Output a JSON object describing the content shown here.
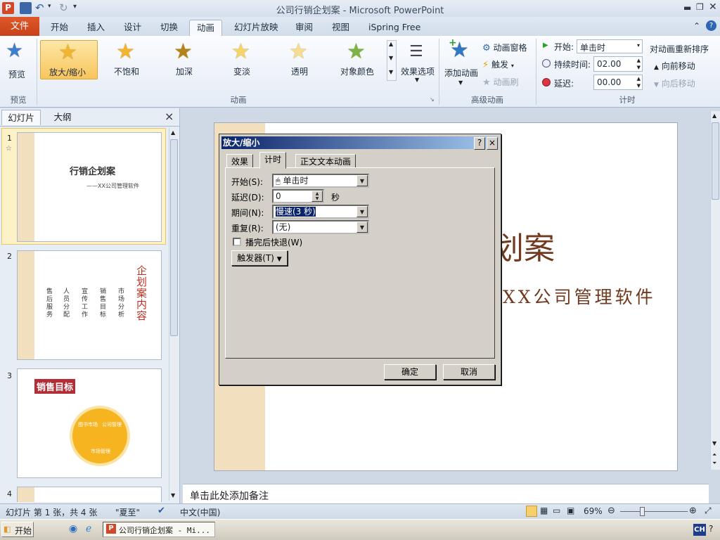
{
  "window": {
    "title": "公司行销企划案 - Microsoft PowerPoint",
    "app_icon": "P"
  },
  "tabs": {
    "file": "文件",
    "items": [
      "开始",
      "插入",
      "设计",
      "切换",
      "动画",
      "幻灯片放映",
      "审阅",
      "视图",
      "iSpring Free"
    ],
    "active_index": 4
  },
  "ribbon": {
    "preview": {
      "label": "预览",
      "group": "预览"
    },
    "animations": {
      "group": "动画",
      "items": [
        "放大/缩小",
        "不饱和",
        "加深",
        "变淡",
        "透明",
        "对象颜色"
      ],
      "selected_index": 0,
      "effect_options": "效果选项"
    },
    "advanced": {
      "group": "高级动画",
      "add_animation": "添加动画",
      "animation_pane": "动画窗格",
      "trigger": "触发",
      "animation_painter": "动画刷"
    },
    "timing": {
      "group": "计时",
      "start_label": "开始:",
      "start_value": "单击时",
      "duration_label": "持续时间:",
      "duration_value": "02.00",
      "delay_label": "延迟:",
      "delay_value": "00.00",
      "reorder_title": "对动画重新排序",
      "move_earlier": "向前移动",
      "move_later": "向后移动"
    }
  },
  "left_panel": {
    "tabs": [
      "幻灯片",
      "大纲"
    ],
    "close": "×",
    "slides": [
      {
        "num": "1",
        "title": "行销企划案",
        "subtitle": "——XX公司管理软件"
      },
      {
        "num": "2",
        "title": "企划案内容",
        "cols": [
          "市场分析",
          "销售目标",
          "宣传工作",
          "人员分配",
          "售后服务"
        ]
      },
      {
        "num": "3",
        "title": "销售目标",
        "segments": [
          "图书市场",
          "公司管理",
          "市场管理"
        ]
      },
      {
        "num": "4"
      }
    ]
  },
  "slide": {
    "title_partial": "划案",
    "subtitle_partial": "XX公司管理软件"
  },
  "notes": {
    "placeholder": "单击此处添加备注"
  },
  "dialog": {
    "title": "放大/缩小",
    "help": "?",
    "close": "×",
    "tabs": [
      "效果",
      "计时",
      "正文文本动画"
    ],
    "active_tab": 1,
    "start_label": "开始(S):",
    "start_value": "单击时",
    "delay_label": "延迟(D):",
    "delay_value": "0",
    "delay_unit": "秒",
    "duration_label": "期间(N):",
    "duration_value": "慢速(3 秒)",
    "repeat_label": "重复(R):",
    "repeat_value": "(无)",
    "rewind_label": "播完后快退(W)",
    "rewind_checked": false,
    "triggers_label": "触发器(T)",
    "ok": "确定",
    "cancel": "取消"
  },
  "status": {
    "slide_info": "幻灯片 第 1 张，共 4 张",
    "theme": "\"夏至\"",
    "language": "中文(中国)",
    "zoom": "69%",
    "zoom_percent": 69
  },
  "taskbar": {
    "start": "开始",
    "task": "公司行销企划案 - Mi...",
    "ime": "CH"
  }
}
